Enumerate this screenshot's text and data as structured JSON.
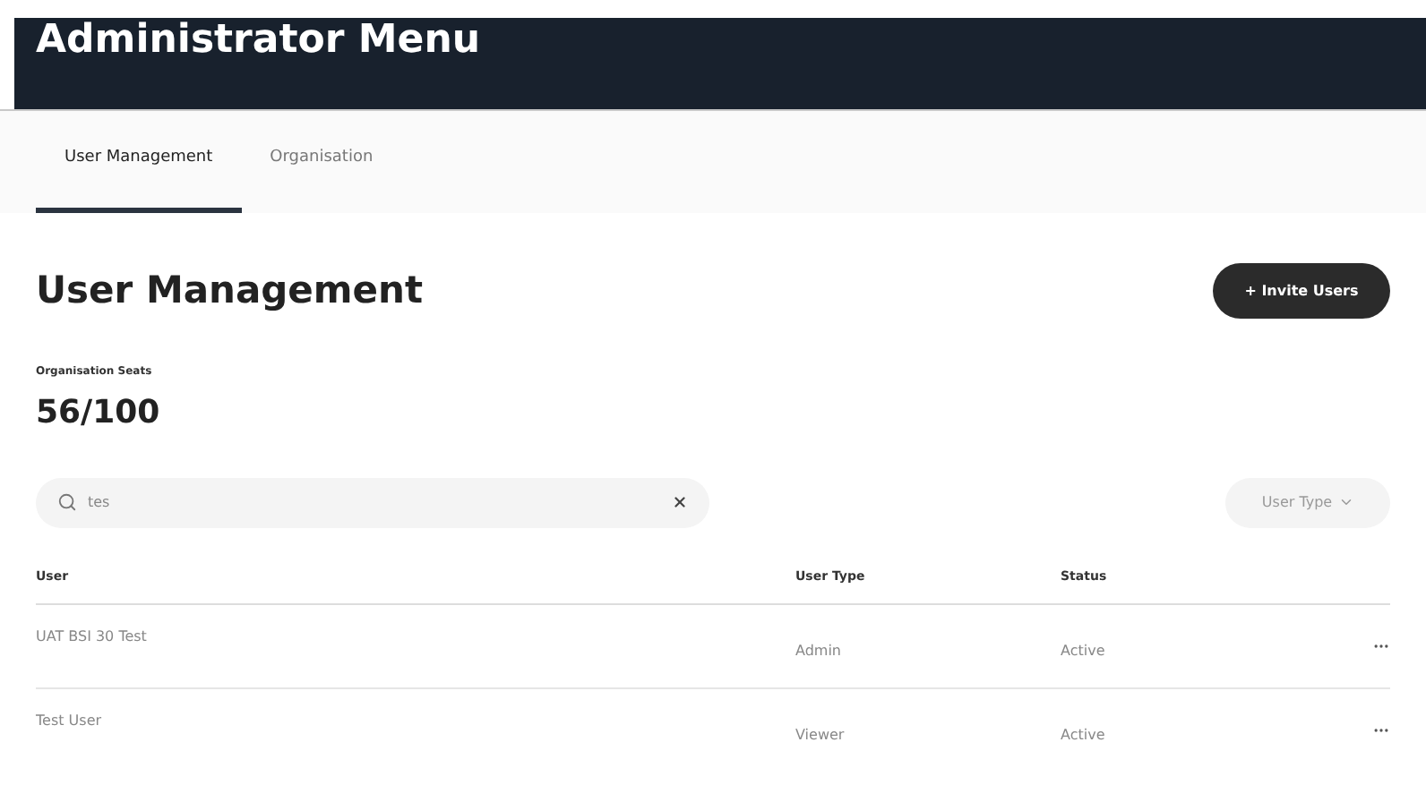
{
  "header": {
    "title": "Administrator Menu"
  },
  "tabs": [
    {
      "label": "User Management",
      "selected": true
    },
    {
      "label": "Organisation",
      "selected": false
    }
  ],
  "page": {
    "title": "User Management",
    "invite_button": "+ Invite Users"
  },
  "seats": {
    "label": "Organisation Seats",
    "value": "56/100"
  },
  "search": {
    "value": "tes"
  },
  "filter": {
    "label": "User Type"
  },
  "table": {
    "columns": [
      "User",
      "User Type",
      "Status"
    ],
    "rows": [
      {
        "user": "UAT BSI 30 Test",
        "user_type": "Admin",
        "status": "Active"
      },
      {
        "user": "Test User",
        "user_type": "Viewer",
        "status": "Active"
      }
    ]
  }
}
